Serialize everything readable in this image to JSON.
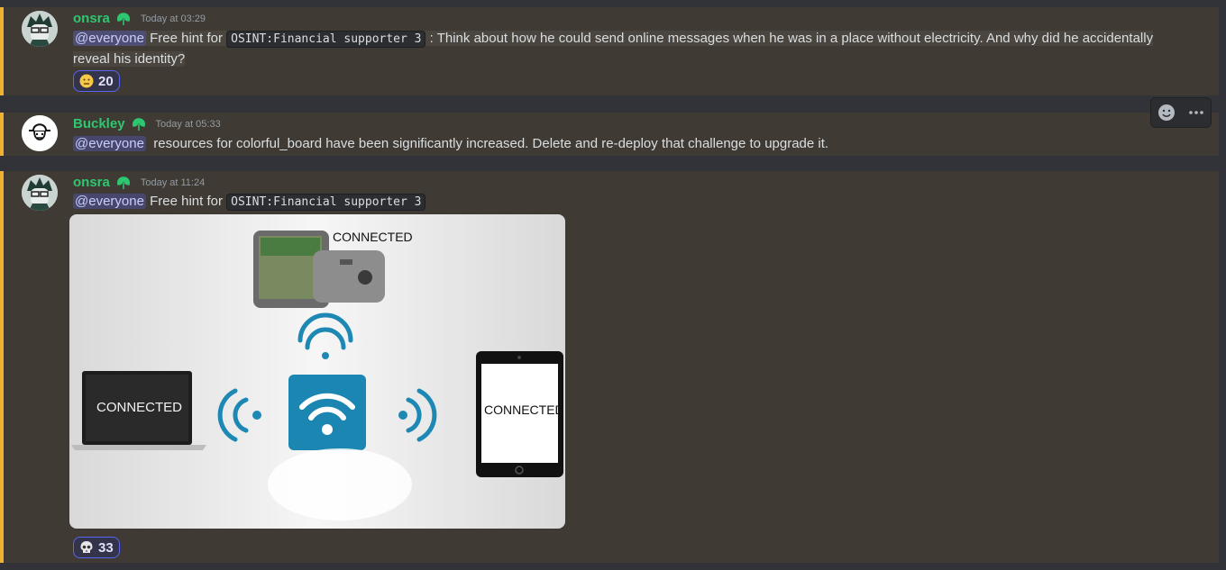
{
  "messages": [
    {
      "username": "onsra",
      "time": "Today at 03:29",
      "mention": "@everyone",
      "text_before": "Free hint for",
      "code": "OSINT:Financial supporter 3",
      "text_after_line1": ": Think about how he could send online messages when he was in a place without electricity. And why did he accidentally",
      "text_after_line2": "reveal his identity?",
      "reaction": {
        "emoji": "neutral-face-icon",
        "count": "20"
      }
    },
    {
      "username": "Buckley",
      "time": "Today at 05:33",
      "mention": "@everyone",
      "text": "resources for colorful_board have been significantly increased. Delete and re-deploy that challenge to upgrade it."
    },
    {
      "username": "onsra",
      "time": "Today at 11:24",
      "mention": "@everyone",
      "text_before": "Free hint for",
      "code": "OSINT:Financial supporter 3",
      "attachment": {
        "phone_label": "CONNECTED",
        "laptop_label": "CONNECTED",
        "tablet_label": "CONNECTED"
      },
      "reaction": {
        "emoji": "skull-icon",
        "count": "33"
      }
    }
  ],
  "hover_actions": [
    "add-reaction-icon",
    "more-options-icon"
  ],
  "colors": {
    "mention_highlight": "#f0b232",
    "username_green": "#2dc770",
    "wifi_blue": "#1e88b4"
  }
}
